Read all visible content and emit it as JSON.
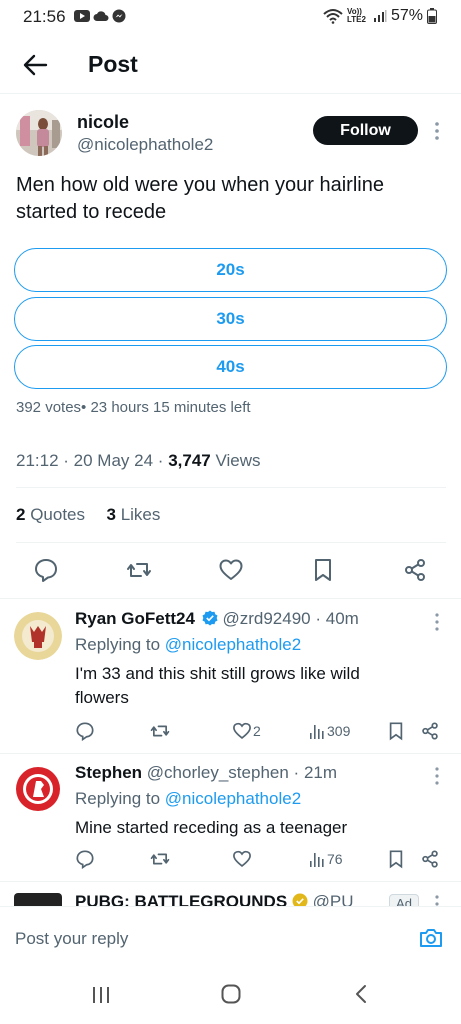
{
  "status_bar": {
    "time": "21:56",
    "network": "Vo)) LTE2",
    "battery": "57%"
  },
  "header": {
    "title": "Post"
  },
  "post": {
    "author_name": "nicole",
    "author_handle": "@nicolephathole2",
    "follow_label": "Follow",
    "text": "Men how old were you when your hairline started to recede",
    "poll": {
      "options": [
        "20s",
        "30s",
        "40s"
      ],
      "meta": "392 votes• 23 hours 15 minutes left"
    },
    "time": "21:12",
    "date": "20 May 24",
    "views_count": "3,747",
    "views_label": "Views",
    "quotes_count": "2",
    "quotes_label": "Quotes",
    "likes_count": "3",
    "likes_label": "Likes"
  },
  "replies": [
    {
      "name": "Ryan GoFett24",
      "verified": true,
      "handle": "@zrd92490",
      "age": "40m",
      "replying_prefix": "Replying to",
      "replying_to": "@nicolephathole2",
      "text": "I'm 33 and this shit still grows like wild flowers",
      "likes": "2",
      "views": "309"
    },
    {
      "name": "Stephen",
      "verified": false,
      "handle": "@chorley_stephen",
      "age": "21m",
      "replying_prefix": "Replying to",
      "replying_to": "@nicolephathole2",
      "text": "Mine started receding as a teenager",
      "likes": "",
      "views": "76"
    }
  ],
  "ad": {
    "name": "PUBG: BATTLEGROUNDS",
    "handle": "@PU",
    "badge": "Ad"
  },
  "composer": {
    "placeholder": "Post your reply"
  },
  "colors": {
    "accent": "#1d9bf0",
    "text": "#0f1419",
    "muted": "#536471",
    "divider": "#eff3f4"
  }
}
